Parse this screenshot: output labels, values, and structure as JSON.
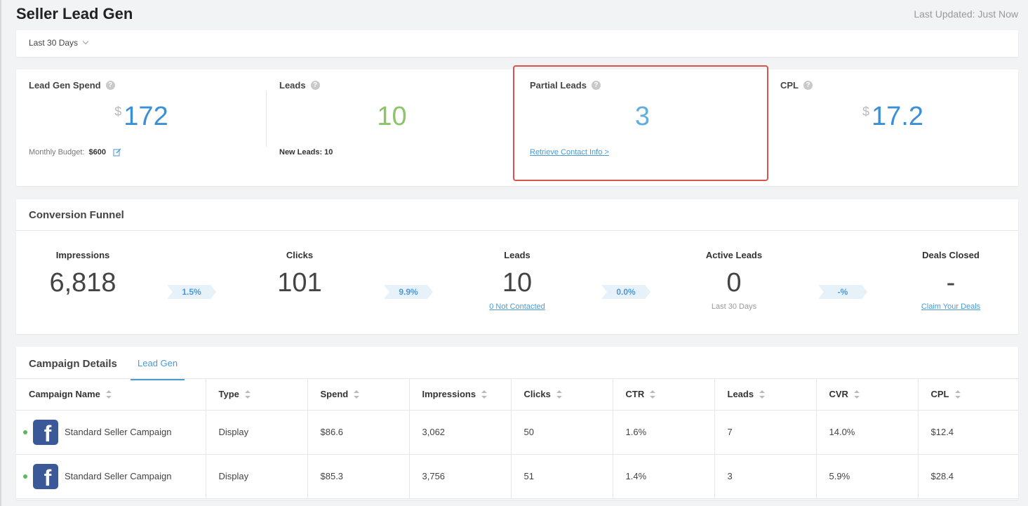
{
  "header": {
    "title": "Seller Lead Gen",
    "last_updated": "Last Updated: Just Now"
  },
  "filter": {
    "date_range": "Last 30 Days"
  },
  "stats": {
    "spend": {
      "label": "Lead Gen Spend",
      "currency": "$",
      "value": "172",
      "budget_label": "Monthly Budget:",
      "budget_value": "$600"
    },
    "leads": {
      "label": "Leads",
      "value": "10",
      "footer": "New Leads: 10"
    },
    "partial": {
      "label": "Partial Leads",
      "value": "3",
      "link": "Retrieve Contact Info >"
    },
    "cpl": {
      "label": "CPL",
      "currency": "$",
      "value": "17.2"
    }
  },
  "funnel": {
    "title": "Conversion Funnel",
    "stages": [
      {
        "label": "Impressions",
        "value": "6,818",
        "sub": ""
      },
      {
        "label": "Clicks",
        "value": "101",
        "sub": ""
      },
      {
        "label": "Leads",
        "value": "10",
        "sub": "0 Not Contacted"
      },
      {
        "label": "Active Leads",
        "value": "0",
        "sub": "Last 30 Days"
      },
      {
        "label": "Deals Closed",
        "value": "-",
        "sub": "Claim Your Deals"
      }
    ],
    "rates": [
      "1.5%",
      "9.9%",
      "0.0%",
      "-%"
    ]
  },
  "campaigns": {
    "title": "Campaign Details",
    "tab": "Lead Gen",
    "columns": [
      "Campaign Name",
      "Type",
      "Spend",
      "Impressions",
      "Clicks",
      "CTR",
      "Leads",
      "CVR",
      "CPL"
    ],
    "rows": [
      {
        "name": "Standard Seller Campaign",
        "type": "Display",
        "spend": "$86.6",
        "impressions": "3,062",
        "clicks": "50",
        "ctr": "1.6%",
        "leads": "7",
        "cvr": "14.0%",
        "cpl": "$12.4"
      },
      {
        "name": "Standard Seller Campaign",
        "type": "Display",
        "spend": "$85.3",
        "impressions": "3,756",
        "clicks": "51",
        "ctr": "1.4%",
        "leads": "3",
        "cvr": "5.9%",
        "cpl": "$28.4"
      }
    ]
  },
  "icons": {
    "help": "question-circle-icon",
    "edit": "edit-icon",
    "facebook": "facebook-icon",
    "status": "status-dot-icon",
    "sort": "sort-icon",
    "dropdown": "chevron-down-icon"
  },
  "colors": {
    "accent_blue": "#3b8fd6",
    "leads_green": "#8cc46a",
    "highlight_red": "#d9534f",
    "facebook_blue": "#3b5998",
    "active_green": "#5cb85c"
  }
}
